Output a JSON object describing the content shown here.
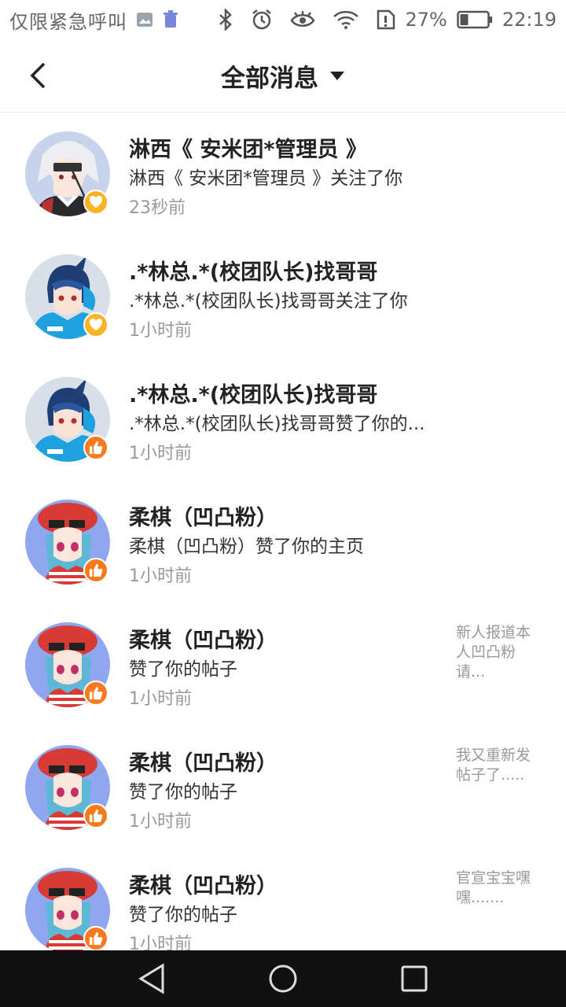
{
  "status_bar": {
    "carrier": "仅限紧急呼叫",
    "battery": "27%",
    "time": "22:19"
  },
  "header": {
    "title": "全部消息"
  },
  "messages": [
    {
      "name": "淋西《 安米团*管理员 》",
      "text": "淋西《 安米团*管理员 》关注了你",
      "time": "23秒前",
      "type": "follow",
      "avatar": "avatar-silver-hair",
      "post": ""
    },
    {
      "name": ".*林总.*(校团队长)找哥哥",
      "text": ".*林总.*(校团队长)找哥哥关注了你",
      "time": "1小时前",
      "type": "follow",
      "avatar": "avatar-blue-hoodie",
      "post": ""
    },
    {
      "name": ".*林总.*(校团队长)找哥哥",
      "text": ".*林总.*(校团队长)找哥哥赞了你的...",
      "time": "1小时前",
      "type": "like",
      "avatar": "avatar-blue-hoodie",
      "post": ""
    },
    {
      "name": "柔棋（凹凸粉）",
      "text": "柔棋（凹凸粉）赞了你的主页",
      "time": "1小时前",
      "type": "like",
      "avatar": "avatar-red-beret",
      "post": ""
    },
    {
      "name": "柔棋（凹凸粉）",
      "text": "赞了你的帖子",
      "time": "1小时前",
      "type": "like",
      "avatar": "avatar-red-beret",
      "post": "新人报道本人凹凸粉请..."
    },
    {
      "name": "柔棋（凹凸粉）",
      "text": "赞了你的帖子",
      "time": "1小时前",
      "type": "like",
      "avatar": "avatar-red-beret",
      "post": "我又重新发帖子了....."
    },
    {
      "name": "柔棋（凹凸粉）",
      "text": "赞了你的帖子",
      "time": "1小时前",
      "type": "like",
      "avatar": "avatar-red-beret",
      "post": "官宣宝宝嘿嘿......."
    }
  ],
  "colors": {
    "follow_badge": "#fbb325",
    "like_badge": "#f97a1c"
  }
}
